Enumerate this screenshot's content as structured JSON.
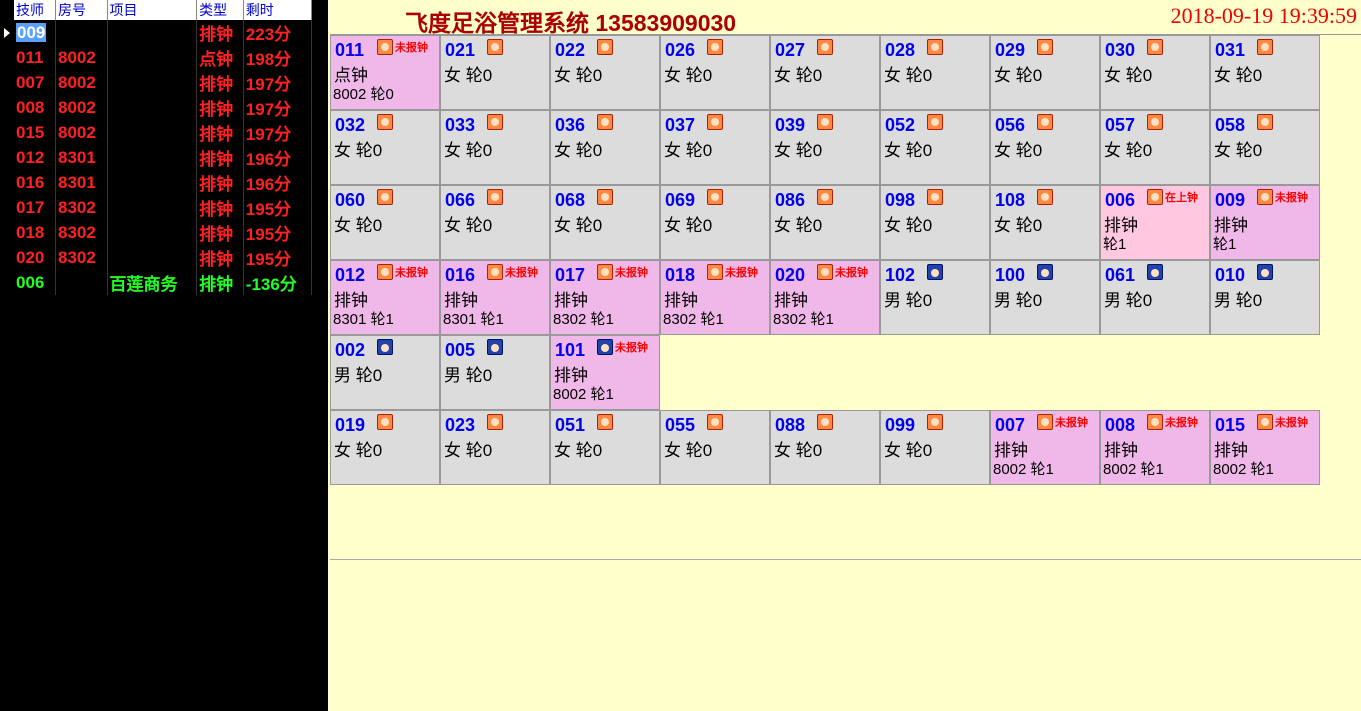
{
  "left_table": {
    "headers": [
      "技师",
      "房号",
      "项目",
      "类型",
      "剩时"
    ],
    "rows": [
      {
        "tech": "009",
        "room": "",
        "item": "",
        "type": "排钟",
        "remain": "223分",
        "color": "red",
        "selected": true
      },
      {
        "tech": "011",
        "room": "8002",
        "item": "",
        "type": "点钟",
        "remain": "198分",
        "color": "red"
      },
      {
        "tech": "007",
        "room": "8002",
        "item": "",
        "type": "排钟",
        "remain": "197分",
        "color": "red"
      },
      {
        "tech": "008",
        "room": "8002",
        "item": "",
        "type": "排钟",
        "remain": "197分",
        "color": "red"
      },
      {
        "tech": "015",
        "room": "8002",
        "item": "",
        "type": "排钟",
        "remain": "197分",
        "color": "red"
      },
      {
        "tech": "012",
        "room": "8301",
        "item": "",
        "type": "排钟",
        "remain": "196分",
        "color": "red"
      },
      {
        "tech": "016",
        "room": "8301",
        "item": "",
        "type": "排钟",
        "remain": "196分",
        "color": "red"
      },
      {
        "tech": "017",
        "room": "8302",
        "item": "",
        "type": "排钟",
        "remain": "195分",
        "color": "red"
      },
      {
        "tech": "018",
        "room": "8302",
        "item": "",
        "type": "排钟",
        "remain": "195分",
        "color": "red"
      },
      {
        "tech": "020",
        "room": "8302",
        "item": "",
        "type": "排钟",
        "remain": "195分",
        "color": "red"
      },
      {
        "tech": "006",
        "room": "",
        "item": "百莲商务",
        "type": "排钟",
        "remain": "-136分",
        "color": "green"
      }
    ]
  },
  "header": {
    "title": "飞度足浴管理系统 13583909030",
    "datetime": "2018-09-19 19:39:59"
  },
  "colors": {
    "idle": "#dcdcdc",
    "busy": "#f0b8e8",
    "on_clock": "#ffc8e0",
    "number": "#0000ee",
    "status": "#ff0000"
  },
  "grid_rows": [
    [
      {
        "num": "011",
        "g": "f",
        "status": "未报钟",
        "l2": "点钟",
        "l3": "8002 轮0",
        "bg": "busy"
      },
      {
        "num": "021",
        "g": "f",
        "l2": "女 轮0"
      },
      {
        "num": "022",
        "g": "f",
        "l2": "女 轮0"
      },
      {
        "num": "026",
        "g": "f",
        "l2": "女 轮0"
      },
      {
        "num": "027",
        "g": "f",
        "l2": "女 轮0"
      },
      {
        "num": "028",
        "g": "f",
        "l2": "女 轮0"
      },
      {
        "num": "029",
        "g": "f",
        "l2": "女 轮0"
      },
      {
        "num": "030",
        "g": "f",
        "l2": "女 轮0"
      },
      {
        "num": "031",
        "g": "f",
        "l2": "女 轮0"
      }
    ],
    [
      {
        "num": "032",
        "g": "f",
        "l2": "女 轮0"
      },
      {
        "num": "033",
        "g": "f",
        "l2": "女 轮0"
      },
      {
        "num": "036",
        "g": "f",
        "l2": "女 轮0"
      },
      {
        "num": "037",
        "g": "f",
        "l2": "女 轮0"
      },
      {
        "num": "039",
        "g": "f",
        "l2": "女 轮0"
      },
      {
        "num": "052",
        "g": "f",
        "l2": "女 轮0"
      },
      {
        "num": "056",
        "g": "f",
        "l2": "女 轮0"
      },
      {
        "num": "057",
        "g": "f",
        "l2": "女 轮0"
      },
      {
        "num": "058",
        "g": "f",
        "l2": "女 轮0"
      }
    ],
    [
      {
        "num": "060",
        "g": "f",
        "l2": "女 轮0"
      },
      {
        "num": "066",
        "g": "f",
        "l2": "女 轮0"
      },
      {
        "num": "068",
        "g": "f",
        "l2": "女 轮0"
      },
      {
        "num": "069",
        "g": "f",
        "l2": "女 轮0"
      },
      {
        "num": "086",
        "g": "f",
        "l2": "女 轮0"
      },
      {
        "num": "098",
        "g": "f",
        "l2": "女 轮0"
      },
      {
        "num": "108",
        "g": "f",
        "l2": "女 轮0"
      },
      {
        "num": "006",
        "g": "f",
        "status": "在上钟",
        "l2": "排钟",
        "l3": " 轮1",
        "bg": "on"
      },
      {
        "num": "009",
        "g": "f",
        "status": "未报钟",
        "l2": "排钟",
        "l3": " 轮1",
        "bg": "busy"
      }
    ],
    [
      {
        "num": "012",
        "g": "f",
        "status": "未报钟",
        "l2": "排钟",
        "l3": "8301 轮1",
        "bg": "busy"
      },
      {
        "num": "016",
        "g": "f",
        "status": "未报钟",
        "l2": "排钟",
        "l3": "8301 轮1",
        "bg": "busy"
      },
      {
        "num": "017",
        "g": "f",
        "status": "未报钟",
        "l2": "排钟",
        "l3": "8302 轮1",
        "bg": "busy"
      },
      {
        "num": "018",
        "g": "f",
        "status": "未报钟",
        "l2": "排钟",
        "l3": "8302 轮1",
        "bg": "busy"
      },
      {
        "num": "020",
        "g": "f",
        "status": "未报钟",
        "l2": "排钟",
        "l3": "8302 轮1",
        "bg": "busy"
      },
      {
        "num": "102",
        "g": "m",
        "l2": "男 轮0"
      },
      {
        "num": "100",
        "g": "m",
        "l2": "男 轮0"
      },
      {
        "num": "061",
        "g": "m",
        "l2": "男 轮0"
      },
      {
        "num": "010",
        "g": "m",
        "l2": "男 轮0"
      }
    ],
    [
      {
        "num": "002",
        "g": "m",
        "l2": "男 轮0"
      },
      {
        "num": "005",
        "g": "m",
        "l2": "男 轮0"
      },
      {
        "num": "101",
        "g": "m",
        "status": "未报钟",
        "l2": "排钟",
        "l3": "8002 轮1",
        "bg": "busy"
      }
    ],
    [
      {
        "num": "019",
        "g": "f",
        "l2": "女 轮0"
      },
      {
        "num": "023",
        "g": "f",
        "l2": "女 轮0"
      },
      {
        "num": "051",
        "g": "f",
        "l2": "女 轮0"
      },
      {
        "num": "055",
        "g": "f",
        "l2": "女 轮0"
      },
      {
        "num": "088",
        "g": "f",
        "l2": "女 轮0"
      },
      {
        "num": "099",
        "g": "f",
        "l2": "女 轮0"
      },
      {
        "num": "007",
        "g": "f",
        "status": "未报钟",
        "l2": "排钟",
        "l3": "8002 轮1",
        "bg": "busy"
      },
      {
        "num": "008",
        "g": "f",
        "status": "未报钟",
        "l2": "排钟",
        "l3": "8002 轮1",
        "bg": "busy"
      },
      {
        "num": "015",
        "g": "f",
        "status": "未报钟",
        "l2": "排钟",
        "l3": "8002 轮1",
        "bg": "busy"
      }
    ]
  ]
}
